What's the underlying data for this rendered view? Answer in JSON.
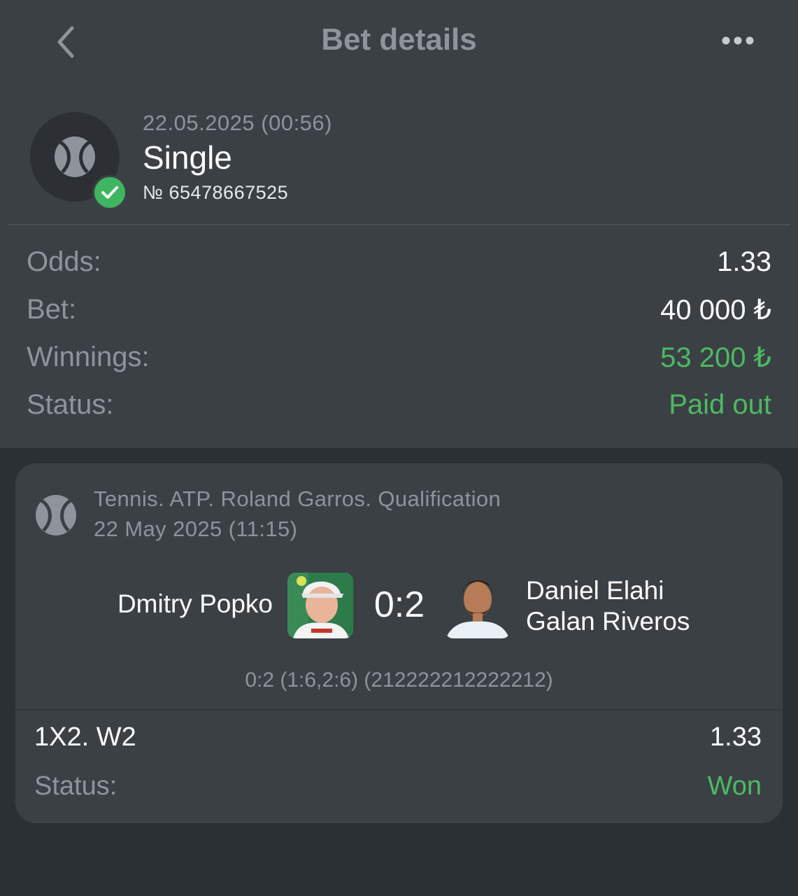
{
  "header": {
    "title": "Bet details"
  },
  "summary": {
    "date": "22.05.2025 (00:56)",
    "type": "Single",
    "number": "№ 65478667525",
    "rows": [
      {
        "label": "Odds:",
        "value": "1.33"
      },
      {
        "label": "Bet:",
        "value": "40 000 ₺"
      },
      {
        "label": "Winnings:",
        "value": "53 200 ₺"
      },
      {
        "label": "Status:",
        "value": "Paid out"
      }
    ]
  },
  "event": {
    "title": "Tennis. ATP. Roland Garros. Qualification",
    "date": "22 May 2025 (11:15)",
    "player1": "Dmitry Popko",
    "player2_line1": "Daniel Elahi",
    "player2_line2": "Galan Riveros",
    "score": "0:2",
    "score_details": "0:2 (1:6,2:6) (212222212222212)"
  },
  "selection": {
    "market": "1X2. W2",
    "odds": "1.33",
    "status_label": "Status:",
    "status_value": "Won"
  },
  "colors": {
    "background_top": "#3b4045",
    "background_bottom": "#2b3034",
    "accent_green": "#4cba63",
    "muted_text": "#8e949a"
  },
  "icons": [
    "back-chevron-icon",
    "more-dots-icon",
    "tennis-ball-icon",
    "check-icon"
  ]
}
